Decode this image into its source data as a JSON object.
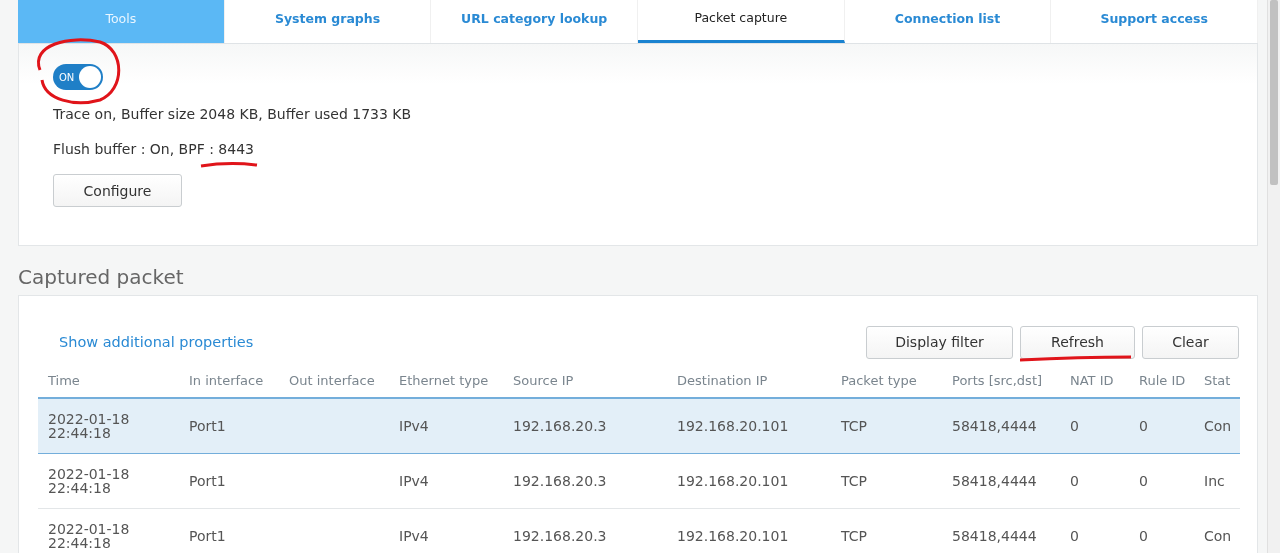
{
  "tabs": [
    {
      "label": "Tools",
      "kind": "section",
      "selected": false
    },
    {
      "label": "System graphs",
      "kind": "tab",
      "selected": false
    },
    {
      "label": "URL category lookup",
      "kind": "tab",
      "selected": false
    },
    {
      "label": "Packet capture",
      "kind": "tab",
      "selected": true
    },
    {
      "label": "Connection list",
      "kind": "tab",
      "selected": false
    },
    {
      "label": "Support access",
      "kind": "tab",
      "selected": false
    }
  ],
  "capture_panel": {
    "toggle": {
      "label": "ON",
      "on": true
    },
    "status_lines": [
      "Trace on, Buffer size 2048 KB, Buffer used 1733 KB",
      "Flush buffer : On, BPF : 8443"
    ],
    "configure_button": "Configure"
  },
  "captured_packet": {
    "title": "Captured packet",
    "link": "Show additional properties",
    "buttons": [
      "Display filter",
      "Refresh",
      "Clear"
    ],
    "table": {
      "columns": [
        "Time",
        "In interface",
        "Out interface",
        "Ethernet type",
        "Source IP",
        "Destination IP",
        "Packet type",
        "Ports [src,dst]",
        "NAT ID",
        "Rule ID",
        "Stat"
      ],
      "rows": [
        {
          "selected": true,
          "cells": [
            "2022-01-18 22:44:18",
            "Port1",
            "",
            "IPv4",
            "192.168.20.3",
            "192.168.20.101",
            "TCP",
            "58418,4444",
            "0",
            "0",
            "Con"
          ]
        },
        {
          "selected": false,
          "cells": [
            "2022-01-18 22:44:18",
            "Port1",
            "",
            "IPv4",
            "192.168.20.3",
            "192.168.20.101",
            "TCP",
            "58418,4444",
            "0",
            "0",
            "Inc"
          ]
        },
        {
          "selected": false,
          "cells": [
            "2022-01-18 22:44:18",
            "Port1",
            "",
            "IPv4",
            "192.168.20.3",
            "192.168.20.101",
            "TCP",
            "58418,4444",
            "0",
            "0",
            "Con"
          ]
        }
      ]
    }
  }
}
